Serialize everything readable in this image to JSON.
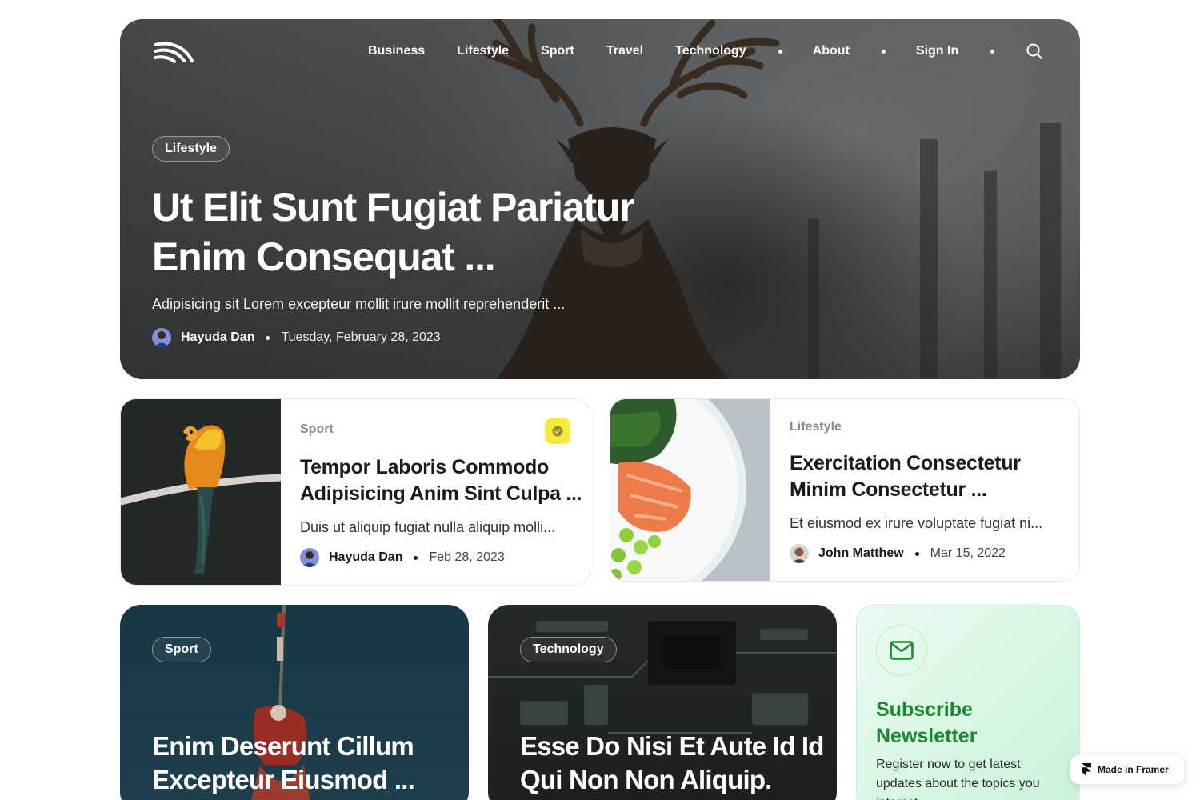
{
  "nav": {
    "items": [
      "Business",
      "Lifestyle",
      "Sport",
      "Travel",
      "Technology"
    ],
    "about": "About",
    "sign_in": "Sign In",
    "icons": {
      "logo": "waves-logo-icon",
      "search": "search-icon"
    }
  },
  "hero": {
    "category": "Lifestyle",
    "title": "Ut Elit Sunt Fugiat Pariatur Enim Consequat ...",
    "excerpt": "Adipisicing sit Lorem excepteur mollit irure mollit reprehenderit ...",
    "author": "Hayuda Dan",
    "date": "Tuesday, February 28, 2023"
  },
  "cards": [
    {
      "category": "Sport",
      "title_line1": "Tempor Laboris Commodo",
      "title_line2": "Adipisicing Anim Sint Culpa ...",
      "excerpt": "Duis ut aliquip fugiat nulla aliquip molli...",
      "author": "Hayuda Dan",
      "date": "Feb 28, 2023",
      "badge_color": "#f3ea3c"
    },
    {
      "category": "Lifestyle",
      "title_line1": "Exercitation Consectetur",
      "title_line2": "Minim Consectetur ...",
      "excerpt": "Et eiusmod ex irure voluptate fugiat ni...",
      "author": "John Matthew",
      "date": "Mar 15, 2022"
    }
  ],
  "featured": [
    {
      "category": "Sport",
      "title": "Enim Deserunt Cillum Excepteur Eiusmod ..."
    },
    {
      "category": "Technology",
      "title": "Esse Do Nisi Et Aute Id Id Qui Non Non Aliquip."
    }
  ],
  "newsletter": {
    "title": "Subscribe Newsletter",
    "text": "Register now to get latest updates about the topics you interest",
    "accent": "#188a2e"
  },
  "framer_badge": "Made in Framer"
}
